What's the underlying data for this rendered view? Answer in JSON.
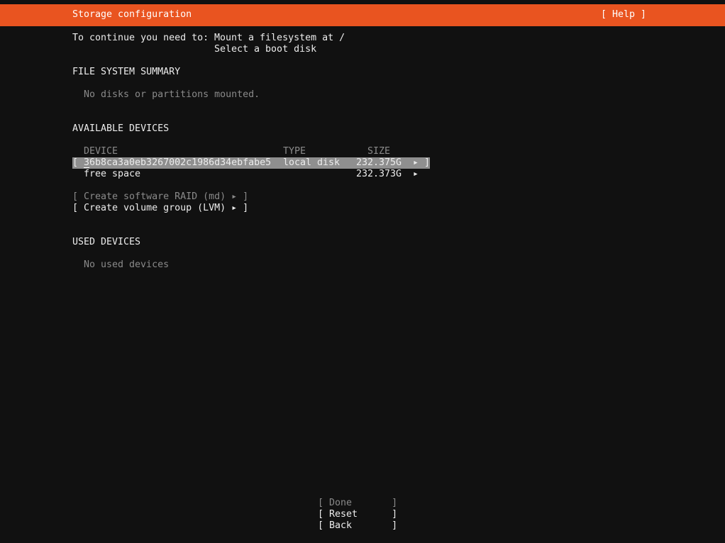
{
  "header": {
    "title": "Storage configuration",
    "help": "[ Help ]"
  },
  "requirements": {
    "label": "To continue you need to:",
    "items": [
      "Mount a filesystem at /",
      "Select a boot disk"
    ]
  },
  "fs_summary": {
    "heading": "FILE SYSTEM SUMMARY",
    "empty": "No disks or partitions mounted."
  },
  "available": {
    "heading": "AVAILABLE DEVICES",
    "columns": [
      "DEVICE",
      "TYPE",
      "SIZE"
    ],
    "rows": [
      {
        "open": "[",
        "device": "36b8ca3a0eb3267002c1986d34ebfabe5",
        "type": "local disk",
        "size": "232.375G",
        "arrow": "▸",
        "close": "]"
      },
      {
        "device": "free space",
        "size": "232.373G",
        "arrow": "▸"
      }
    ],
    "actions": [
      {
        "label": "[ Create software RAID (md) ▸ ]",
        "enabled": false
      },
      {
        "label": "[ Create volume group (LVM) ▸ ]",
        "enabled": true
      }
    ]
  },
  "used": {
    "heading": "USED DEVICES",
    "empty": "No used devices"
  },
  "buttons": [
    {
      "label": "[ Done       ]",
      "enabled": false
    },
    {
      "label": "[ Reset      ]",
      "enabled": true
    },
    {
      "label": "[ Back       ]",
      "enabled": true
    }
  ],
  "colors": {
    "header_bg": "#e95420",
    "background": "#111111",
    "selected_row": "#8f8f8f",
    "disabled_text": "#8a8a8a"
  }
}
